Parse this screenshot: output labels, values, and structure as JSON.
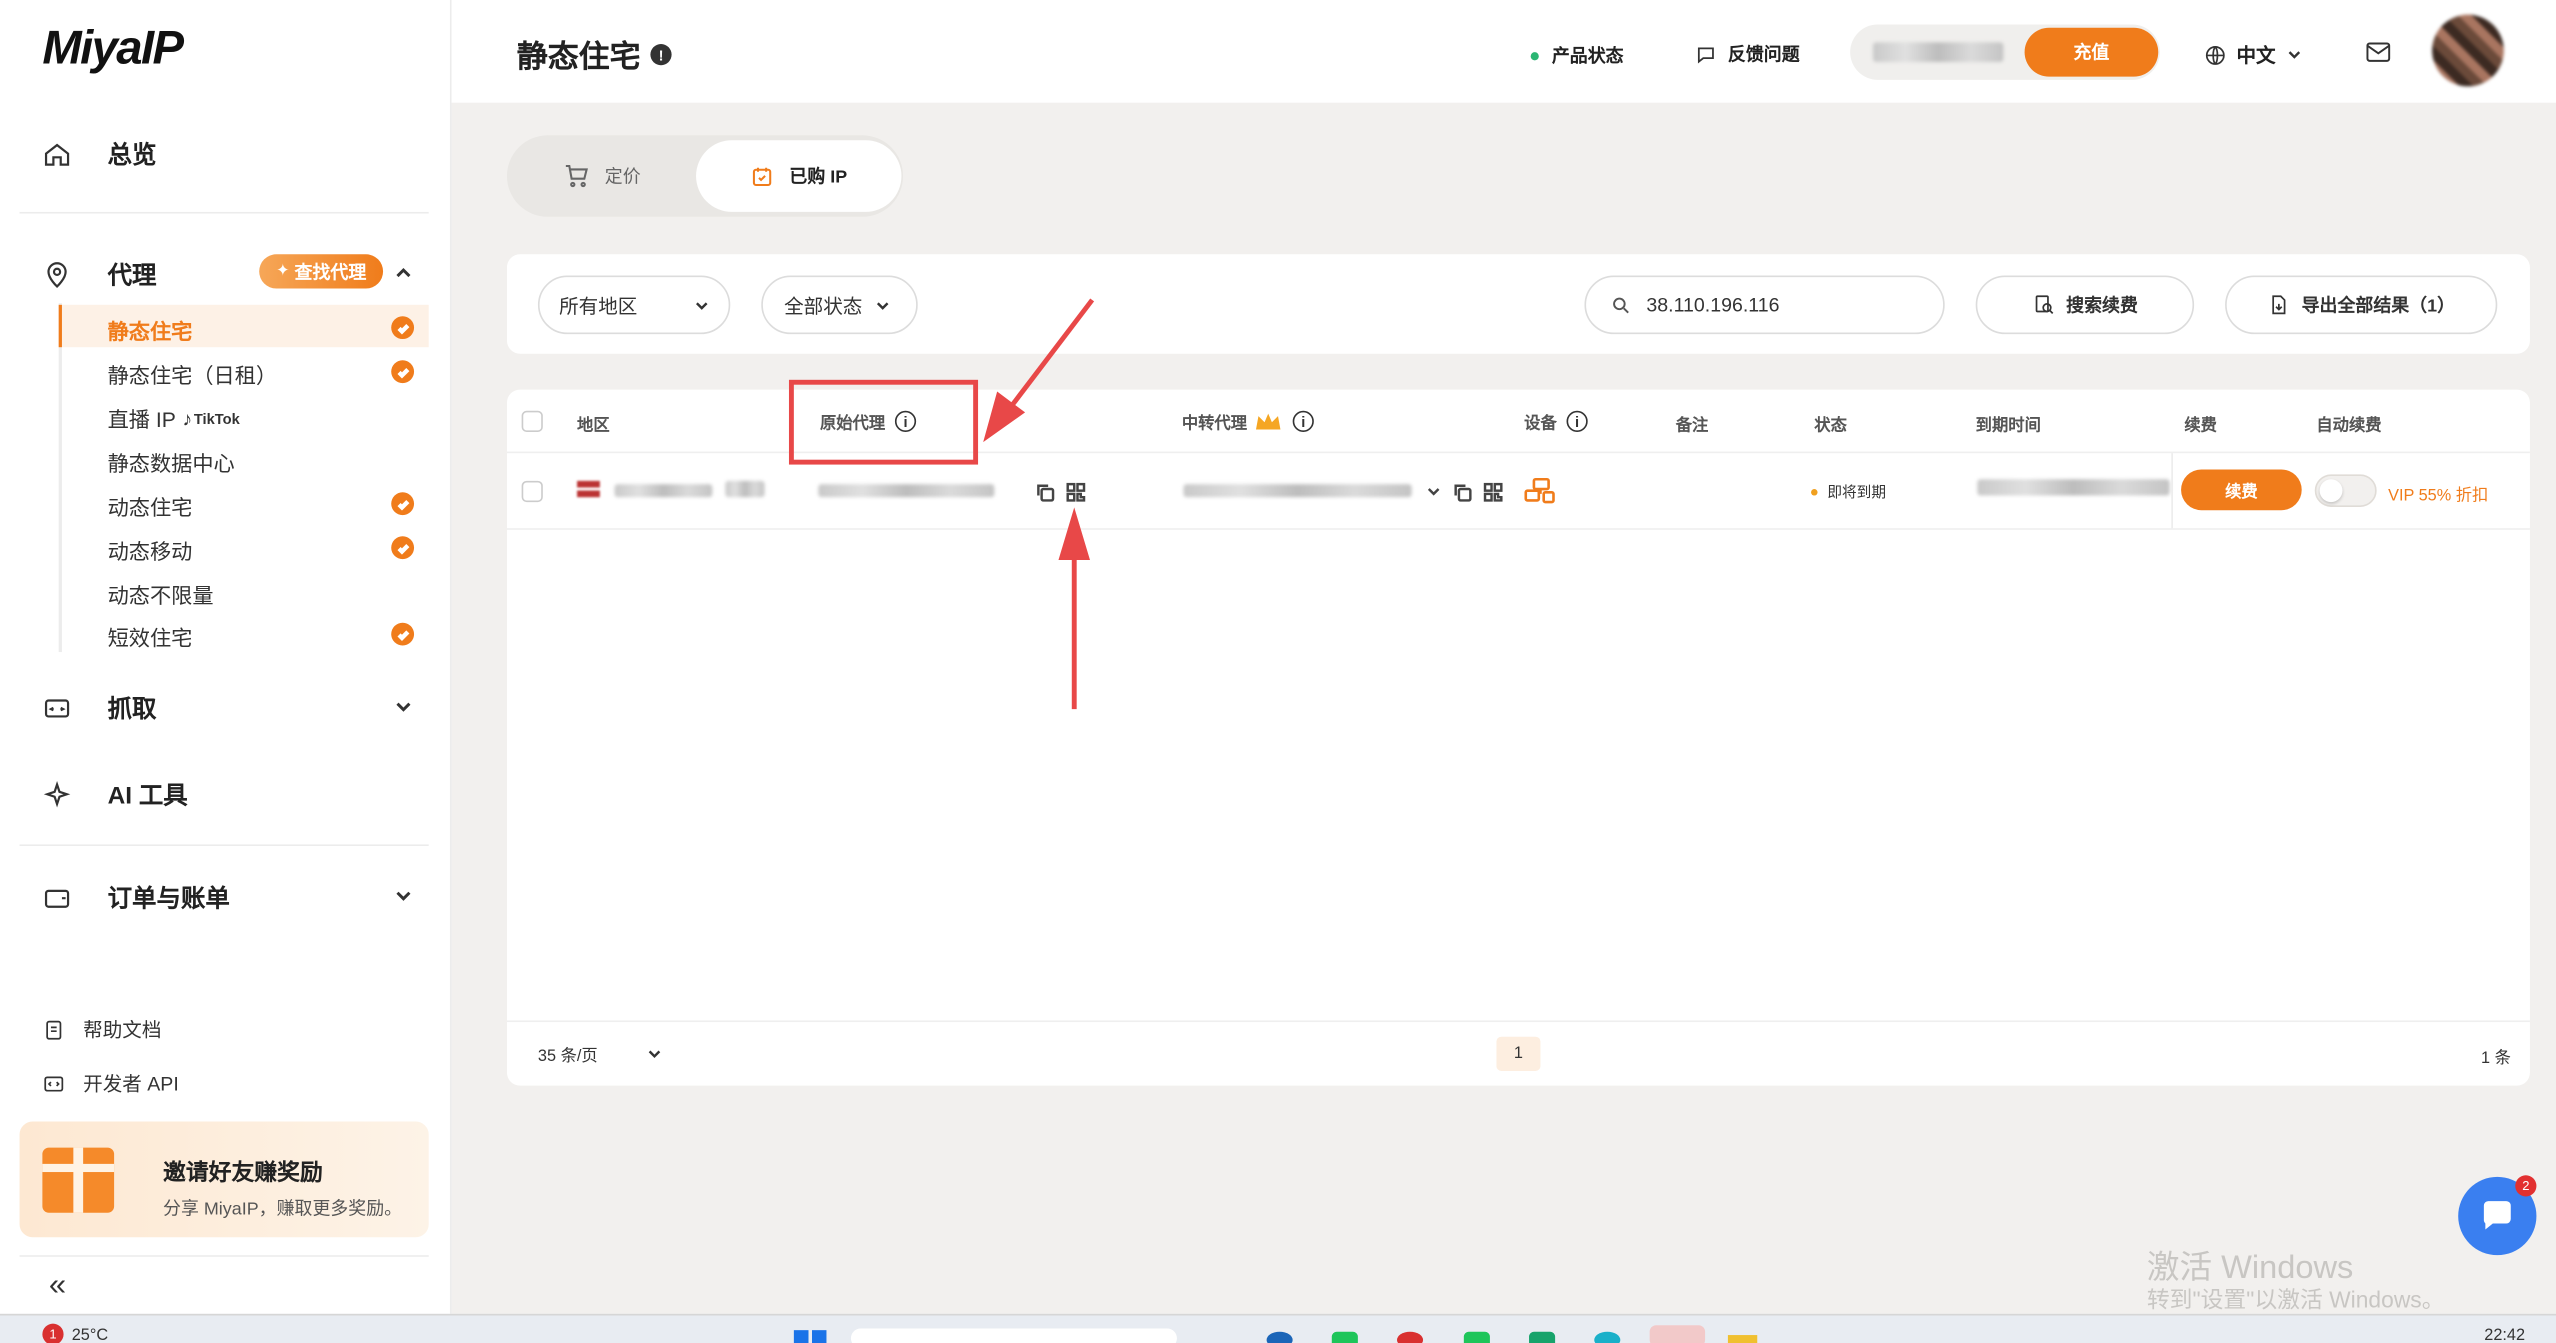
{
  "brand": {
    "logo": "MiyaIP"
  },
  "sidebar": {
    "overview": "总览",
    "proxy": {
      "label": "代理",
      "find_badge": "查找代理"
    },
    "proxy_items": [
      {
        "label": "静态住宅",
        "checked": true,
        "active": true
      },
      {
        "label": "静态住宅（日租）",
        "checked": true
      },
      {
        "label": "直播 IP",
        "checked": false,
        "extra": "TikTok"
      },
      {
        "label": "静态数据中心",
        "checked": false
      },
      {
        "label": "动态住宅",
        "checked": true
      },
      {
        "label": "动态移动",
        "checked": true
      },
      {
        "label": "动态不限量",
        "checked": false
      },
      {
        "label": "短效住宅",
        "checked": true
      }
    ],
    "crawl": "抓取",
    "ai_tools": "AI 工具",
    "orders": "订单与账单",
    "help_docs": "帮助文档",
    "dev_api": "开发者 API",
    "invite": {
      "title": "邀请好友赚奖励",
      "subtitle": "分享 MiyaIP，赚取更多奖励。"
    },
    "collapse_icon": "double-chevron-left-icon"
  },
  "header": {
    "title": "静态住宅",
    "product_status": "产品状态",
    "feedback": "反馈问题",
    "recharge": "充值",
    "language": "中文"
  },
  "tabs": {
    "pricing": "定价",
    "purchased": "已购 IP"
  },
  "filters": {
    "region": "所有地区",
    "status": "全部状态",
    "search_value": "38.110.196.116",
    "search_renew": "搜索续费",
    "export_all": "导出全部结果（1）"
  },
  "table": {
    "headers": {
      "region": "地区",
      "original_proxy": "原始代理",
      "relay_proxy": "中转代理",
      "device": "设备",
      "remark": "备注",
      "status": "状态",
      "expire_time": "到期时间",
      "renew": "续费",
      "auto_renew": "自动续费"
    },
    "rows": [
      {
        "status": "即将到期",
        "renew_button": "续费",
        "vip": "VIP 55% 折扣",
        "auto_renew_on": false
      }
    ]
  },
  "pagination": {
    "per_page": "35 条/页",
    "current_page": "1",
    "total": "1 条"
  },
  "watermark": {
    "line1": "激活 Windows",
    "line2": "转到\"设置\"以激活 Windows。"
  },
  "chat_badge": "2",
  "taskbar": {
    "weather": "25°C",
    "weather_badge": "1",
    "time": "22:42"
  },
  "colors": {
    "accent": "#f07c1b",
    "annotation_red": "#e84848",
    "status_dot": "#f0a020"
  }
}
